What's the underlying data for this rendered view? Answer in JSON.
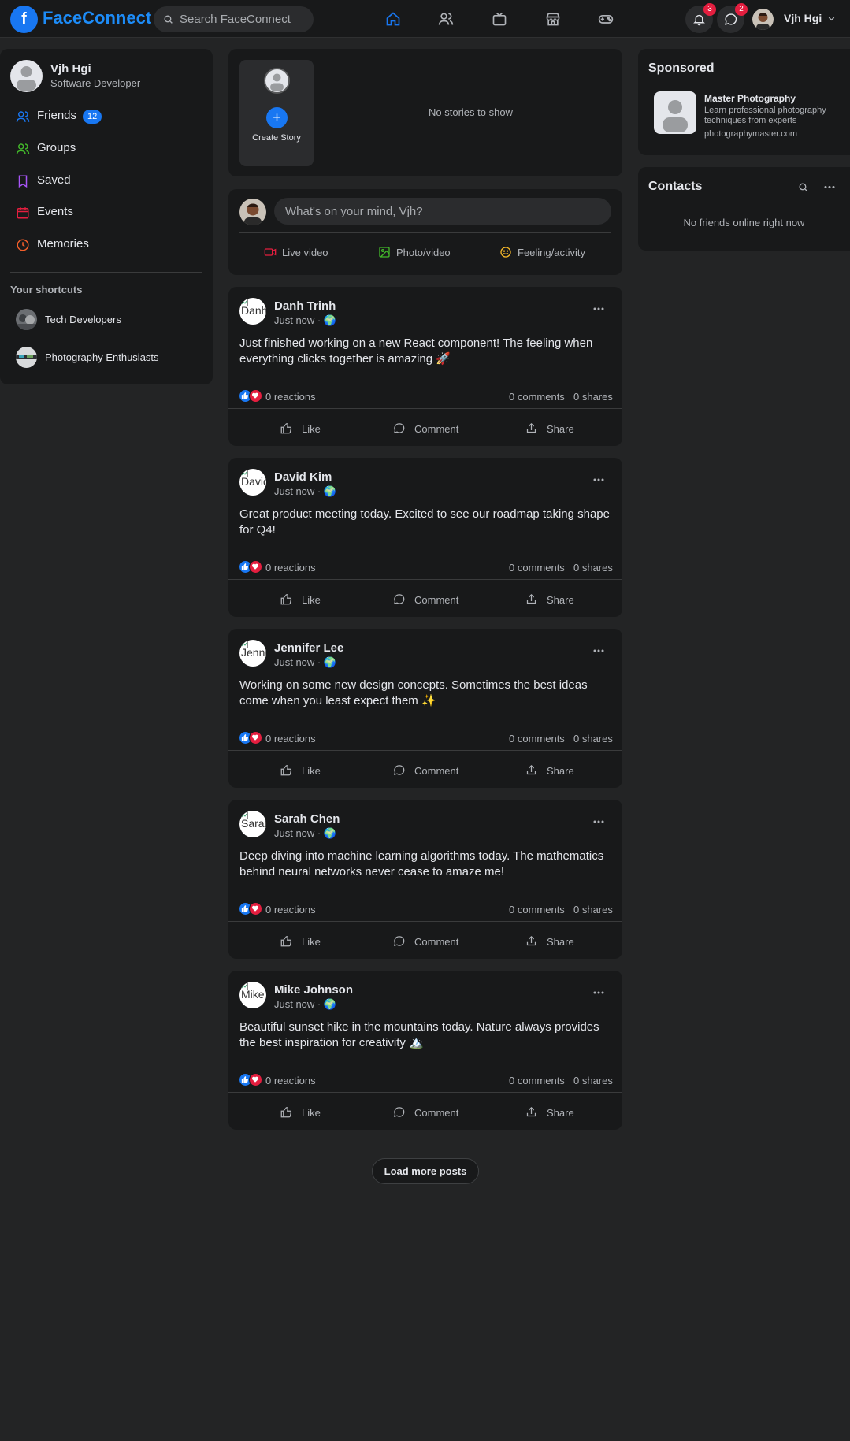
{
  "header": {
    "logo_letter": "f",
    "brand": "FaceConnect",
    "search_placeholder": "Search FaceConnect",
    "notifications_count": "3",
    "messages_count": "2",
    "username": "Vjh Hgi",
    "nav_icons": [
      "home-icon",
      "friends-icon",
      "watch-icon",
      "marketplace-icon",
      "gaming-icon"
    ]
  },
  "sidebar": {
    "profile_name": "Vjh Hgi",
    "profile_role": "Software Developer",
    "items": [
      {
        "label": "Friends",
        "icon": "friends-icon",
        "color": "#1877f2",
        "count": "12"
      },
      {
        "label": "Groups",
        "icon": "groups-icon",
        "color": "#42b72a"
      },
      {
        "label": "Saved",
        "icon": "bookmark-icon",
        "color": "#a855f7"
      },
      {
        "label": "Events",
        "icon": "calendar-icon",
        "color": "#e41e3f"
      },
      {
        "label": "Memories",
        "icon": "clock-icon",
        "color": "#f35f2a"
      }
    ],
    "shortcuts_title": "Your shortcuts",
    "shortcuts": [
      {
        "label": "Tech Developers"
      },
      {
        "label": "Photography Enthusiasts"
      }
    ]
  },
  "stories": {
    "create_label": "Create Story",
    "plus": "+",
    "empty_text": "No stories to show"
  },
  "composer": {
    "placeholder": "What's on your mind, Vjh?",
    "live_label": "Live video",
    "photo_label": "Photo/video",
    "feeling_label": "Feeling/activity"
  },
  "posts": [
    {
      "author": "Danh Trinh",
      "avatar_alt": "Danh",
      "meta": "Just now · 🌍",
      "text": "Just finished working on a new React component! The feeling when everything clicks together is amazing 🚀",
      "reactions": "0 reactions",
      "comments": "0 comments",
      "shares": "0 shares"
    },
    {
      "author": "David Kim",
      "avatar_alt": "David",
      "meta": "Just now · 🌍",
      "text": "Great product meeting today. Excited to see our roadmap taking shape for Q4!",
      "reactions": "0 reactions",
      "comments": "0 comments",
      "shares": "0 shares"
    },
    {
      "author": "Jennifer Lee",
      "avatar_alt": "Jennifer",
      "meta": "Just now · 🌍",
      "text": "Working on some new design concepts. Sometimes the best ideas come when you least expect them ✨",
      "reactions": "0 reactions",
      "comments": "0 comments",
      "shares": "0 shares"
    },
    {
      "author": "Sarah Chen",
      "avatar_alt": "Sarah",
      "meta": "Just now · 🌍",
      "text": "Deep diving into machine learning algorithms today. The mathematics behind neural networks never cease to amaze me!",
      "reactions": "0 reactions",
      "comments": "0 comments",
      "shares": "0 shares"
    },
    {
      "author": "Mike Johnson",
      "avatar_alt": "Mike",
      "meta": "Just now · 🌍",
      "text": "Beautiful sunset hike in the mountains today. Nature always provides the best inspiration for creativity 🏔️",
      "reactions": "0 reactions",
      "comments": "0 comments",
      "shares": "0 shares"
    }
  ],
  "post_actions": {
    "like": "Like",
    "comment": "Comment",
    "share": "Share"
  },
  "feed": {
    "load_more": "Load more posts"
  },
  "sponsored": {
    "title": "Sponsored",
    "ad_title": "Master Photography",
    "ad_desc": "Learn professional photography techniques from experts",
    "ad_url": "photographymaster.com"
  },
  "contacts": {
    "title": "Contacts",
    "empty": "No friends online right now"
  },
  "colors": {
    "accent": "#1877f2",
    "background": "#232425",
    "card": "#18191a",
    "badge": "#e41e3f"
  }
}
